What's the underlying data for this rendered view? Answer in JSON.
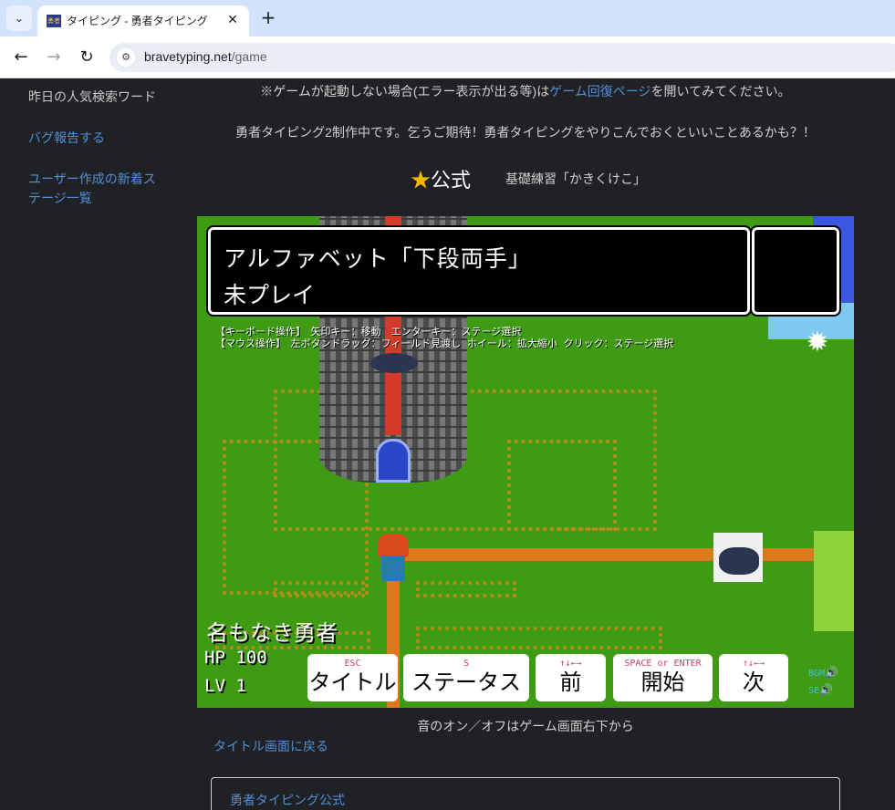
{
  "browser": {
    "tab_title": "タイピング - 勇者タイピング",
    "favicon_text": "勇者",
    "tab_list_icon": "⌄",
    "close_icon": "✕",
    "new_tab_icon": "+",
    "back_icon": "←",
    "forward_icon": "→",
    "reload_icon": "↻",
    "site_info_icon": "⚙",
    "url_host": "bravetyping.net",
    "url_path": "/game"
  },
  "sidebar": {
    "items": [
      {
        "label": "昨日の人気検索ワード"
      },
      {
        "label": "バグ報告する"
      },
      {
        "label": "ユーザー作成の新着ステージ一覧"
      }
    ]
  },
  "notice": {
    "prefix": "※ゲームが起動しない場合(エラー表示が出る等)は",
    "link": "ゲーム回復ページ",
    "suffix": "を開いてみてください。"
  },
  "announcement": "勇者タイピング2制作中です。乞うご期待！勇者タイピングをやりこんでおくといいことあるかも？！",
  "stage_header": {
    "star_icon": "★",
    "official_label": "公式",
    "stage_name": "基礎練習「かきくけこ」"
  },
  "game": {
    "stage_title": "アルファベット「下段両手」",
    "stage_status": "未プレイ",
    "gear_icon": "✹",
    "help_keyboard": "【キーボード操作】　矢印キー：移動　エンターキー：ステージ選択",
    "help_mouse": "【マウス操作】　左ボタンドラッグ：フィールド見渡し ホイール：拡大縮小 クリック：ステージ選択",
    "hero_name": "名もなき勇者",
    "hp": "HP 100",
    "lv": "LV 1",
    "buttons": [
      {
        "key": "ESC",
        "label": "タイトル"
      },
      {
        "key": "S",
        "label": "ステータス"
      },
      {
        "key": "↑↓←→",
        "label": "前"
      },
      {
        "key": "SPACE or ENTER",
        "label": "開始"
      },
      {
        "key": "↑↓←→",
        "label": "次"
      }
    ],
    "bgm_label": "BGM",
    "se_label": "SE",
    "speaker_icon": "🔊"
  },
  "below_note": "音のオン／オフはゲーム画面右下から",
  "back_link": "タイトル画面に戻る",
  "card_title": "勇者タイピング公式"
}
